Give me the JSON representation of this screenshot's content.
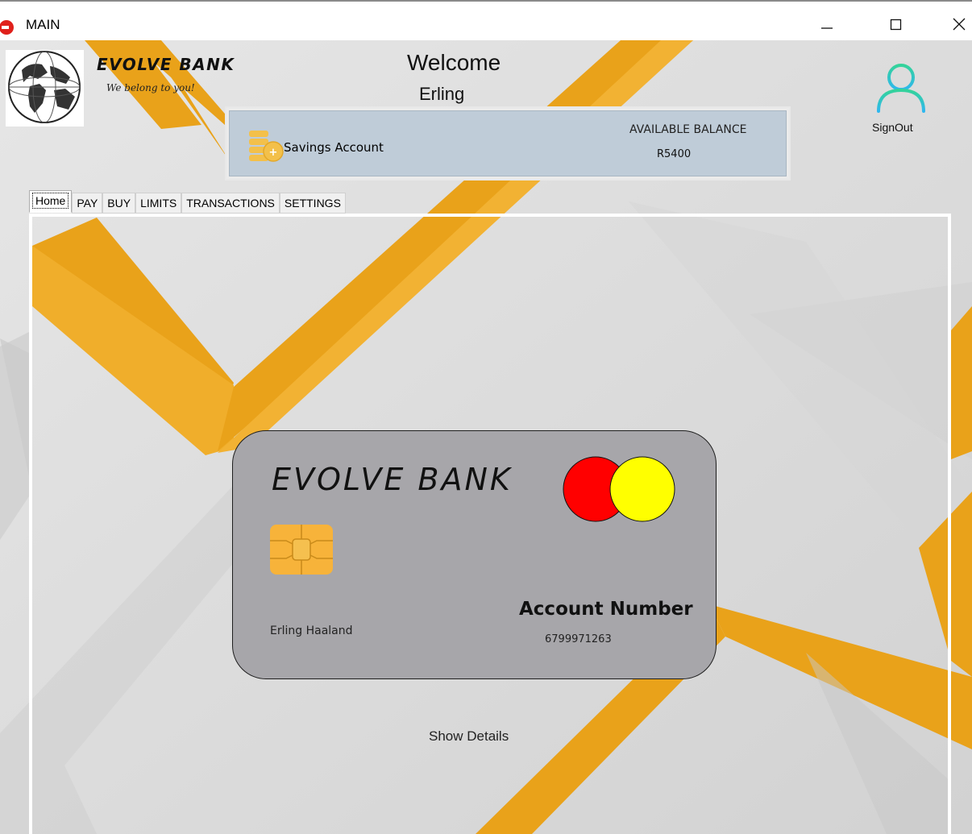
{
  "window": {
    "title": "MAIN",
    "controls": [
      "minimize",
      "maximize",
      "close"
    ]
  },
  "header": {
    "bank_name": "EVOLVE BANK",
    "slogan": "We belong to you!",
    "welcome": "Welcome",
    "user_first_name": "Erling",
    "signout_label": "SignOut"
  },
  "account": {
    "type": "Savings Account",
    "balance_label": "AVAILABLE BALANCE",
    "balance_value": "R5400",
    "icon": "coins-icon"
  },
  "tabs": [
    {
      "label": "Home",
      "active": true
    },
    {
      "label": "PAY",
      "active": false
    },
    {
      "label": "BUY",
      "active": false
    },
    {
      "label": "LIMITS",
      "active": false
    },
    {
      "label": "TRANSACTIONS",
      "active": false
    },
    {
      "label": "SETTINGS",
      "active": false
    }
  ],
  "card": {
    "bank_name": "EVOLVE BANK",
    "holder_name": "Erling Haaland",
    "account_number_label": "Account Number",
    "account_number": "6799971263",
    "logo_colors": [
      "#ff0000",
      "#ffff00"
    ],
    "chip_icon": "chip-icon"
  },
  "actions": {
    "show_details": "Show Details"
  },
  "colors": {
    "accent_orange": "#e9a21a",
    "panel_blue": "#bfccd8",
    "card_gray": "#a7a6aa",
    "signout_gradient": [
      "#2fc3e6",
      "#34d39a"
    ]
  }
}
